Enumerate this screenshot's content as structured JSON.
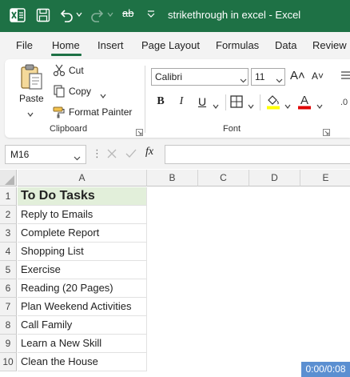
{
  "title_bar": {
    "qa_strikethrough": "ab",
    "doc_title": "strikethrough in excel  -  Excel",
    "colors": {
      "background": "#1e7145"
    }
  },
  "tabs": [
    "File",
    "Home",
    "Insert",
    "Page Layout",
    "Formulas",
    "Data",
    "Review"
  ],
  "active_tab": "Home",
  "ribbon": {
    "clipboard": {
      "paste_label": "Paste",
      "cut_label": "Cut",
      "copy_label": "Copy",
      "format_painter_label": "Format Painter",
      "group_label": "Clipboard"
    },
    "font": {
      "font_name": "Calibri",
      "font_size": "11",
      "grow_glyph": "A˄",
      "shrink_glyph": "A˅",
      "bold": "B",
      "italic": "I",
      "underline": "U",
      "font_color_glyph": "A",
      "group_label": "Font",
      "colors": {
        "font_color_bar": "#e00000",
        "fill_color_bar": "#ffff00"
      }
    }
  },
  "formula_bar": {
    "name_box": "M16",
    "dots": "⋮",
    "fx": "fx",
    "formula": ""
  },
  "sheet": {
    "columns": [
      "A",
      "B",
      "C",
      "D",
      "E"
    ],
    "rows": [
      {
        "num": "1",
        "a": "To Do Tasks"
      },
      {
        "num": "2",
        "a": "Reply to Emails"
      },
      {
        "num": "3",
        "a": "Complete Report"
      },
      {
        "num": "4",
        "a": "Shopping List"
      },
      {
        "num": "5",
        "a": "Exercise"
      },
      {
        "num": "6",
        "a": "Reading (20 Pages)"
      },
      {
        "num": "7",
        "a": "Plan Weekend Activities"
      },
      {
        "num": "8",
        "a": "Call Family"
      },
      {
        "num": "9",
        "a": "Learn a New Skill"
      },
      {
        "num": "10",
        "a": "Clean the House"
      }
    ],
    "colors": {
      "header_fill": "#e2efda"
    }
  },
  "video_timestamp": "0:00/0:08"
}
